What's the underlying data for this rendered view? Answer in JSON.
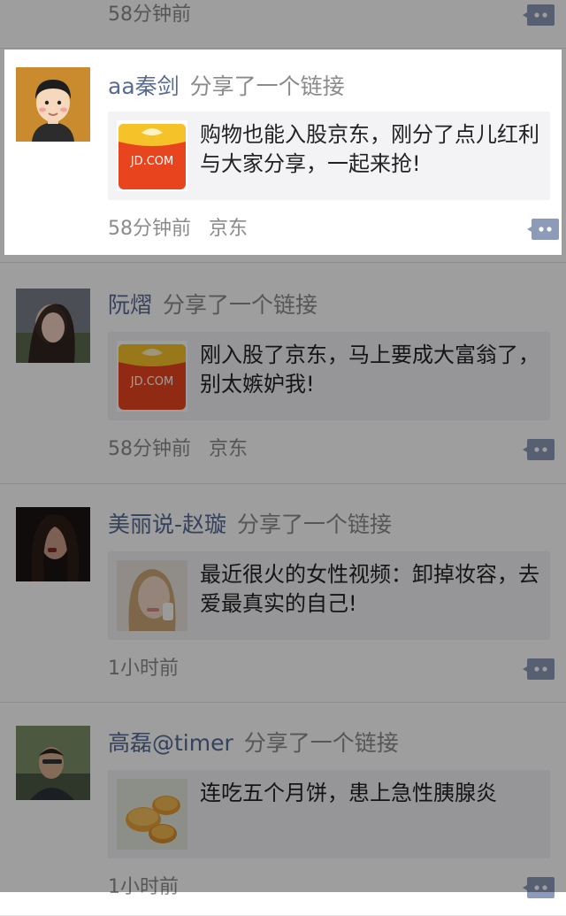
{
  "feed": {
    "partial_top": {
      "time": "58分钟前"
    },
    "posts": [
      {
        "author": "aa秦剑",
        "action": "分享了一个链接",
        "link_text": "购物也能入股京东，刚分了点儿红利与大家分享，一起来抢!",
        "thumb_label": "JD.COM",
        "time": "58分钟前",
        "source": "京东"
      },
      {
        "author": "阮熠",
        "action": "分享了一个链接",
        "link_text": "刚入股了京东，马上要成大富翁了，别太嫉妒我!",
        "thumb_label": "JD.COM",
        "time": "58分钟前",
        "source": "京东"
      },
      {
        "author": "美丽说-赵璇",
        "action": "分享了一个链接",
        "link_text": "最近很火的女性视频：卸掉妆容，去爱最真实的自己!",
        "time": "1小时前"
      },
      {
        "author": "高磊@timer",
        "action": "分享了一个链接",
        "link_text": "连吃五个月饼，患上急性胰腺炎",
        "time": "1小时前"
      }
    ]
  },
  "colors": {
    "author": "#576b95",
    "secondary": "#8b8b8b",
    "card_bg": "#f3f3f5",
    "comment_icon": "#8d9bb8",
    "jd_red": "#e8441e",
    "jd_yellow": "#f6c229"
  },
  "icons": [
    "comment-bubble-icon",
    "jd-logo-icon"
  ]
}
